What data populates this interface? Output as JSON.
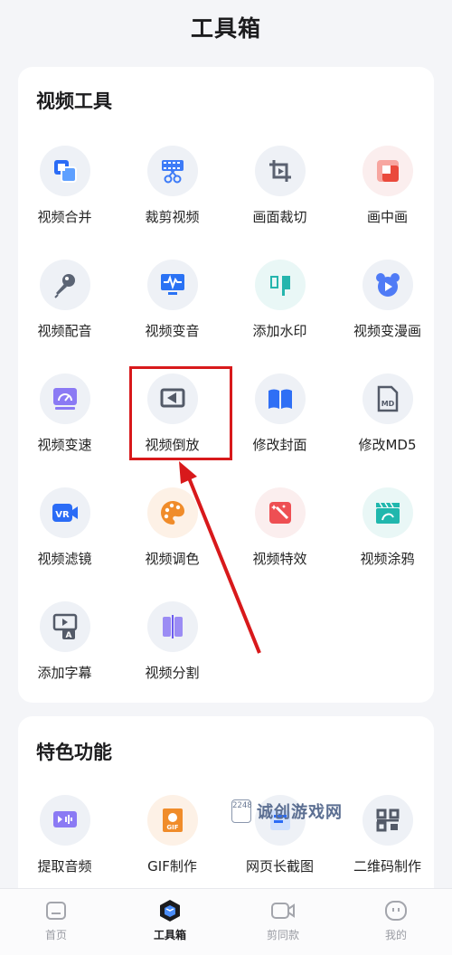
{
  "header": {
    "title": "工具箱"
  },
  "video_tools": {
    "title": "视频工具",
    "items": [
      {
        "label": "视频合并"
      },
      {
        "label": "裁剪视频"
      },
      {
        "label": "画面裁切"
      },
      {
        "label": "画中画"
      },
      {
        "label": "视频配音"
      },
      {
        "label": "视频变音"
      },
      {
        "label": "添加水印"
      },
      {
        "label": "视频变漫画"
      },
      {
        "label": "视频变速"
      },
      {
        "label": "视频倒放"
      },
      {
        "label": "修改封面"
      },
      {
        "label": "修改MD5"
      },
      {
        "label": "视频滤镜"
      },
      {
        "label": "视频调色"
      },
      {
        "label": "视频特效"
      },
      {
        "label": "视频涂鸦"
      },
      {
        "label": "添加字幕"
      },
      {
        "label": "视频分割"
      }
    ]
  },
  "special": {
    "title": "特色功能",
    "items": [
      {
        "label": "提取音频"
      },
      {
        "label": "GIF制作"
      },
      {
        "label": "网页长截图"
      },
      {
        "label": "二维码制作"
      }
    ]
  },
  "watermark": {
    "digits": "2248",
    "text": "诚创游戏网"
  },
  "tabbar": {
    "tabs": [
      {
        "label": "首页"
      },
      {
        "label": "工具箱"
      },
      {
        "label": "剪同款"
      },
      {
        "label": "我的"
      }
    ]
  },
  "colors": {
    "accent_blue": "#2b6cf6",
    "highlight_red": "#d8191b"
  }
}
